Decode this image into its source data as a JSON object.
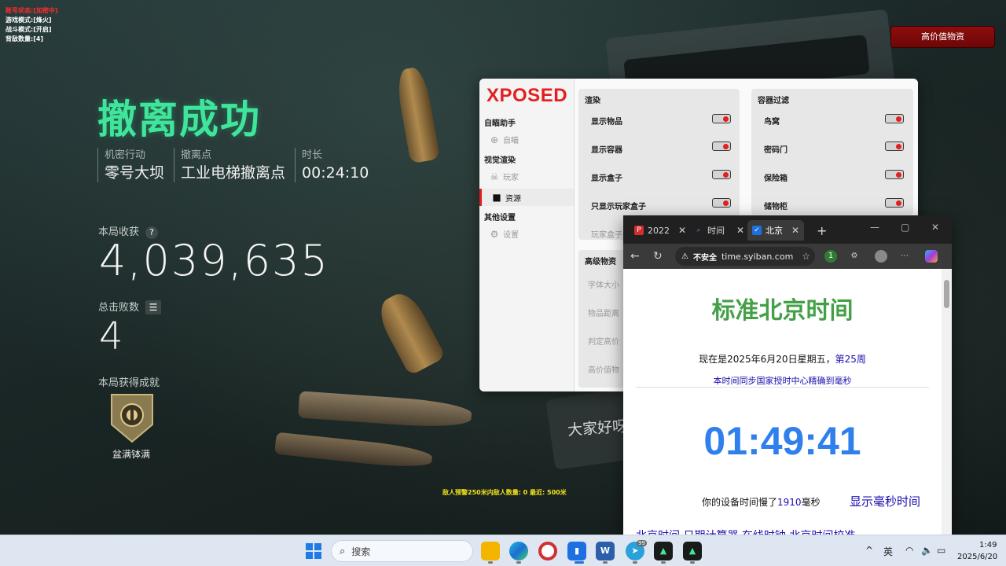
{
  "hud": {
    "account_status": "账号状态:[加密中]",
    "game_mode": "游戏模式:[烽火]",
    "combat_mode": "战斗模式:[开启]",
    "backpack_count": "背敌数量:[4]"
  },
  "high_value_button": "高价值物资",
  "extraction": {
    "title": "撤离成功",
    "info": [
      {
        "label": "机密行动",
        "value": "零号大坝"
      },
      {
        "label": "撤离点",
        "value": "工业电梯撤离点"
      },
      {
        "label": "时长",
        "value": "00:24:10"
      }
    ],
    "earnings_label": "本局收获",
    "earnings_value": "4,039,635",
    "kills_label": "总击败数",
    "kills_value": "4",
    "achievement_label": "本局获得成就",
    "achievement_name": "盆满钵满",
    "enemy_warning": "敌人预警250米内敌人数量: 0  最近: 500米",
    "card_text": "大家好呀"
  },
  "xposed": {
    "logo": "XPOSED",
    "nav": [
      {
        "type": "group",
        "label": "自瞄助手"
      },
      {
        "type": "item",
        "label": "自瞄",
        "icon": "crosshair-icon"
      },
      {
        "type": "group",
        "label": "视觉渲染"
      },
      {
        "type": "item",
        "label": "玩家",
        "icon": "skull-icon"
      },
      {
        "type": "item",
        "label": "资源",
        "icon": "folder-icon",
        "active": true
      },
      {
        "type": "group",
        "label": "其他设置"
      },
      {
        "type": "item",
        "label": "设置",
        "icon": "gear-icon"
      }
    ],
    "render_card": {
      "title": "渲染",
      "options": [
        "显示物品",
        "显示容器",
        "显示盒子",
        "只显示玩家盒子"
      ],
      "dim_option": "玩家盒子"
    },
    "container_card": {
      "title": "容器过滤",
      "options": [
        "鸟窝",
        "密码门",
        "保险箱",
        "储物柜"
      ]
    },
    "hv_card": {
      "title": "高级物资",
      "options": [
        "字体大小",
        "物品距离",
        "判定高价",
        "高价值物"
      ]
    }
  },
  "browser": {
    "tabs": [
      {
        "label": "2022",
        "icon": "pdf-icon"
      },
      {
        "label": "时间",
        "icon": "search-icon"
      },
      {
        "label": "北京",
        "icon": "checkbox-icon",
        "active": true
      }
    ],
    "new_tab": "+",
    "not_secure": "不安全",
    "url": "time.syiban.com",
    "ext_badge": "1",
    "page": {
      "title": "标准北京时间",
      "now_prefix": "现在是2025年6月20日星期五，",
      "week": "第25周",
      "sync_note": "本时间同步国家授时中心精确到毫秒",
      "clock": "01:49:41",
      "slow_prefix": "你的设备时间慢了",
      "slow_ms": "1910",
      "slow_suffix": "毫秒",
      "ms_link": "显示毫秒时间",
      "bottom_links": "北京时间  日期计算器  在线时钟  北京时间校准"
    }
  },
  "taskbar": {
    "search_placeholder": "搜索",
    "tray_chevron": "^",
    "ime": "英",
    "time": "1:49",
    "date": "2025/6/20",
    "badge_99": "99"
  },
  "colors": {
    "accent_green": "#3fe59b",
    "xposed_red": "#e31f1f",
    "page_title_green": "#43a047",
    "clock_blue": "#2f80ed"
  }
}
